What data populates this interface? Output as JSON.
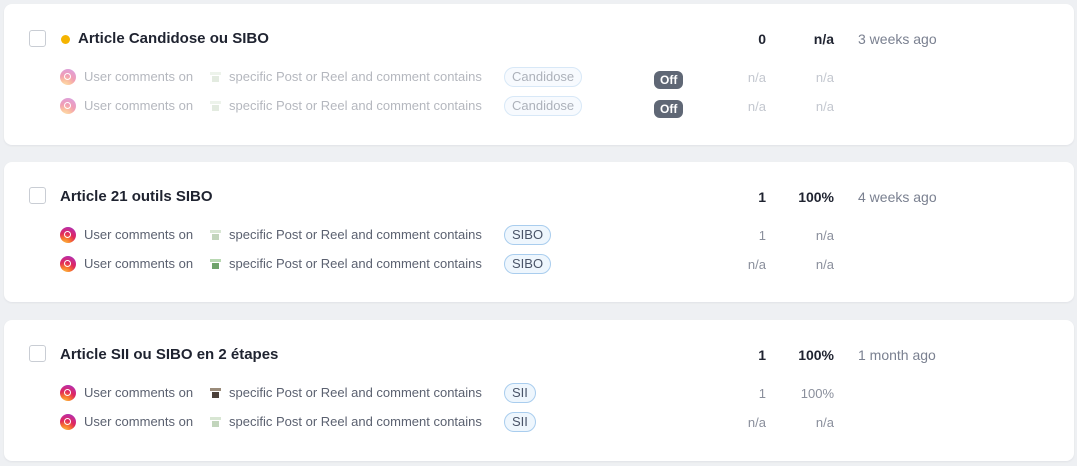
{
  "automations": [
    {
      "title": "Article Candidose ou SIBO",
      "status_color": "#f5b400",
      "count": "0",
      "rate": "n/a",
      "time": "3 weeks ago",
      "rules": [
        {
          "prefix": "User comments on",
          "icon": "instagram-icon",
          "suffix": "specific Post or Reel and comment contains",
          "keyword": "Candidose",
          "toggle": "Off",
          "count": "n/a",
          "rate": "n/a"
        },
        {
          "prefix": "User comments on",
          "icon": "instagram-icon",
          "suffix": "specific Post or Reel and comment contains",
          "keyword": "Candidose",
          "toggle": "Off",
          "count": "n/a",
          "rate": "n/a"
        }
      ]
    },
    {
      "title": "Article 21 outils SIBO",
      "count": "1",
      "rate": "100%",
      "time": "4 weeks ago",
      "rules": [
        {
          "prefix": "User comments on",
          "icon": "instagram-icon",
          "suffix": "specific Post or Reel and comment contains",
          "keyword": "SIBO",
          "count": "1",
          "rate": "n/a"
        },
        {
          "prefix": "User comments on",
          "icon": "instagram-icon",
          "suffix": "specific Post or Reel and comment contains",
          "keyword": "SIBO",
          "count": "n/a",
          "rate": "n/a"
        }
      ]
    },
    {
      "title": "Article SII ou SIBO en 2 étapes",
      "count": "1",
      "rate": "100%",
      "time": "1 month ago",
      "rules": [
        {
          "prefix": "User comments on",
          "icon": "instagram-icon",
          "suffix": "specific Post or Reel and comment contains",
          "keyword": "SII",
          "count": "1",
          "rate": "100%"
        },
        {
          "prefix": "User comments on",
          "icon": "instagram-icon",
          "suffix": "specific Post or Reel and comment contains",
          "keyword": "SII",
          "count": "n/a",
          "rate": "n/a"
        }
      ]
    }
  ]
}
